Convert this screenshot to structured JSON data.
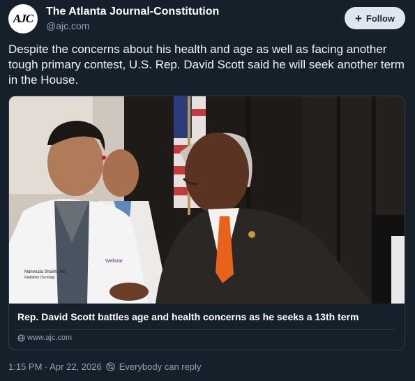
{
  "author": {
    "avatar_text": "AJC",
    "name": "The Atlanta Journal-Constitution",
    "handle": "@ajc.com"
  },
  "follow": {
    "icon": "plus-icon",
    "label": "Follow"
  },
  "post": {
    "text": "Despite the concerns about his health and age as well as facing another tough primary contest, U.S. Rep. David Scott said he will seek another term in the House."
  },
  "link_card": {
    "image_text": {
      "badge_name": "Mahmuda Shaikh, MD",
      "badge_dept": "Radiation Oncology",
      "brand": "Wellstar"
    },
    "title": "Rep. David Scott battles age and health concerns as he seeks a 13th term",
    "domain": "www.ajc.com"
  },
  "meta": {
    "timestamp": "1:15 PM · Apr 22, 2026",
    "reply_setting": "Everybody can reply"
  },
  "colors": {
    "background": "#16202b",
    "muted_text": "#8fa3b8",
    "follow_button_bg": "#dfe6ee",
    "card_border": "#2e3c4b",
    "tie": "#e8621a"
  }
}
